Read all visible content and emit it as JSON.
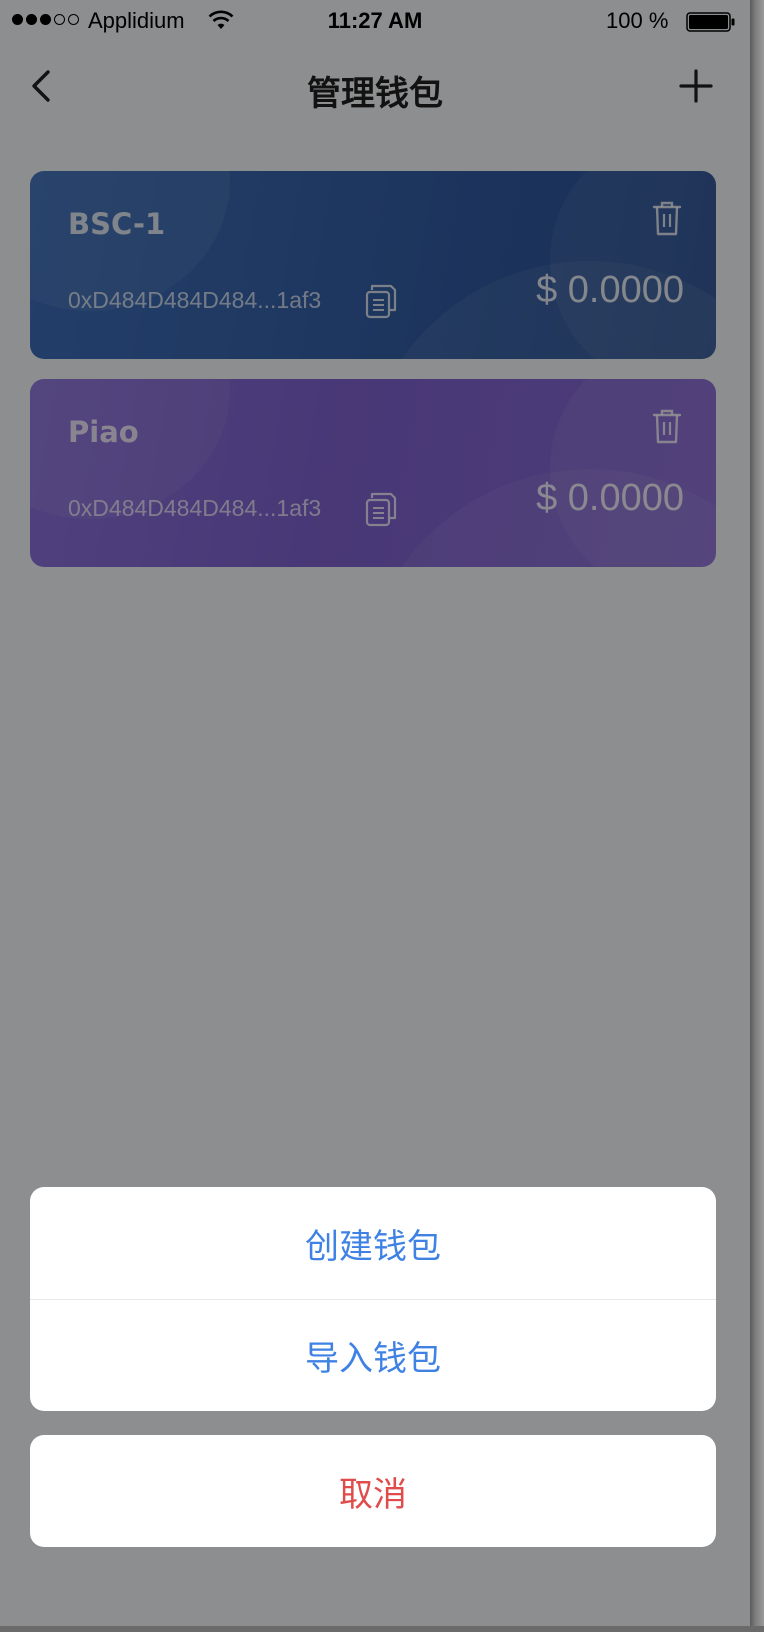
{
  "status_bar": {
    "carrier": "Applidium",
    "time": "11:27 AM",
    "battery": "100 %"
  },
  "nav": {
    "title": "管理钱包",
    "back_icon": "chevron-left-icon",
    "add_icon": "plus-icon"
  },
  "wallets": [
    {
      "name": "BSC-1",
      "address": "0xD484D484D484...1af3",
      "balance": "$ 0.0000",
      "color": "#3561a8"
    },
    {
      "name": "Piao",
      "address": "0xD484D484D484...1af3",
      "balance": "$ 0.0000",
      "color": "#7e60cc"
    }
  ],
  "action_sheet": {
    "create_label": "创建钱包",
    "import_label": "导入钱包",
    "cancel_label": "取消",
    "action_color": "#3f82e4",
    "cancel_color": "#e04c4c"
  }
}
